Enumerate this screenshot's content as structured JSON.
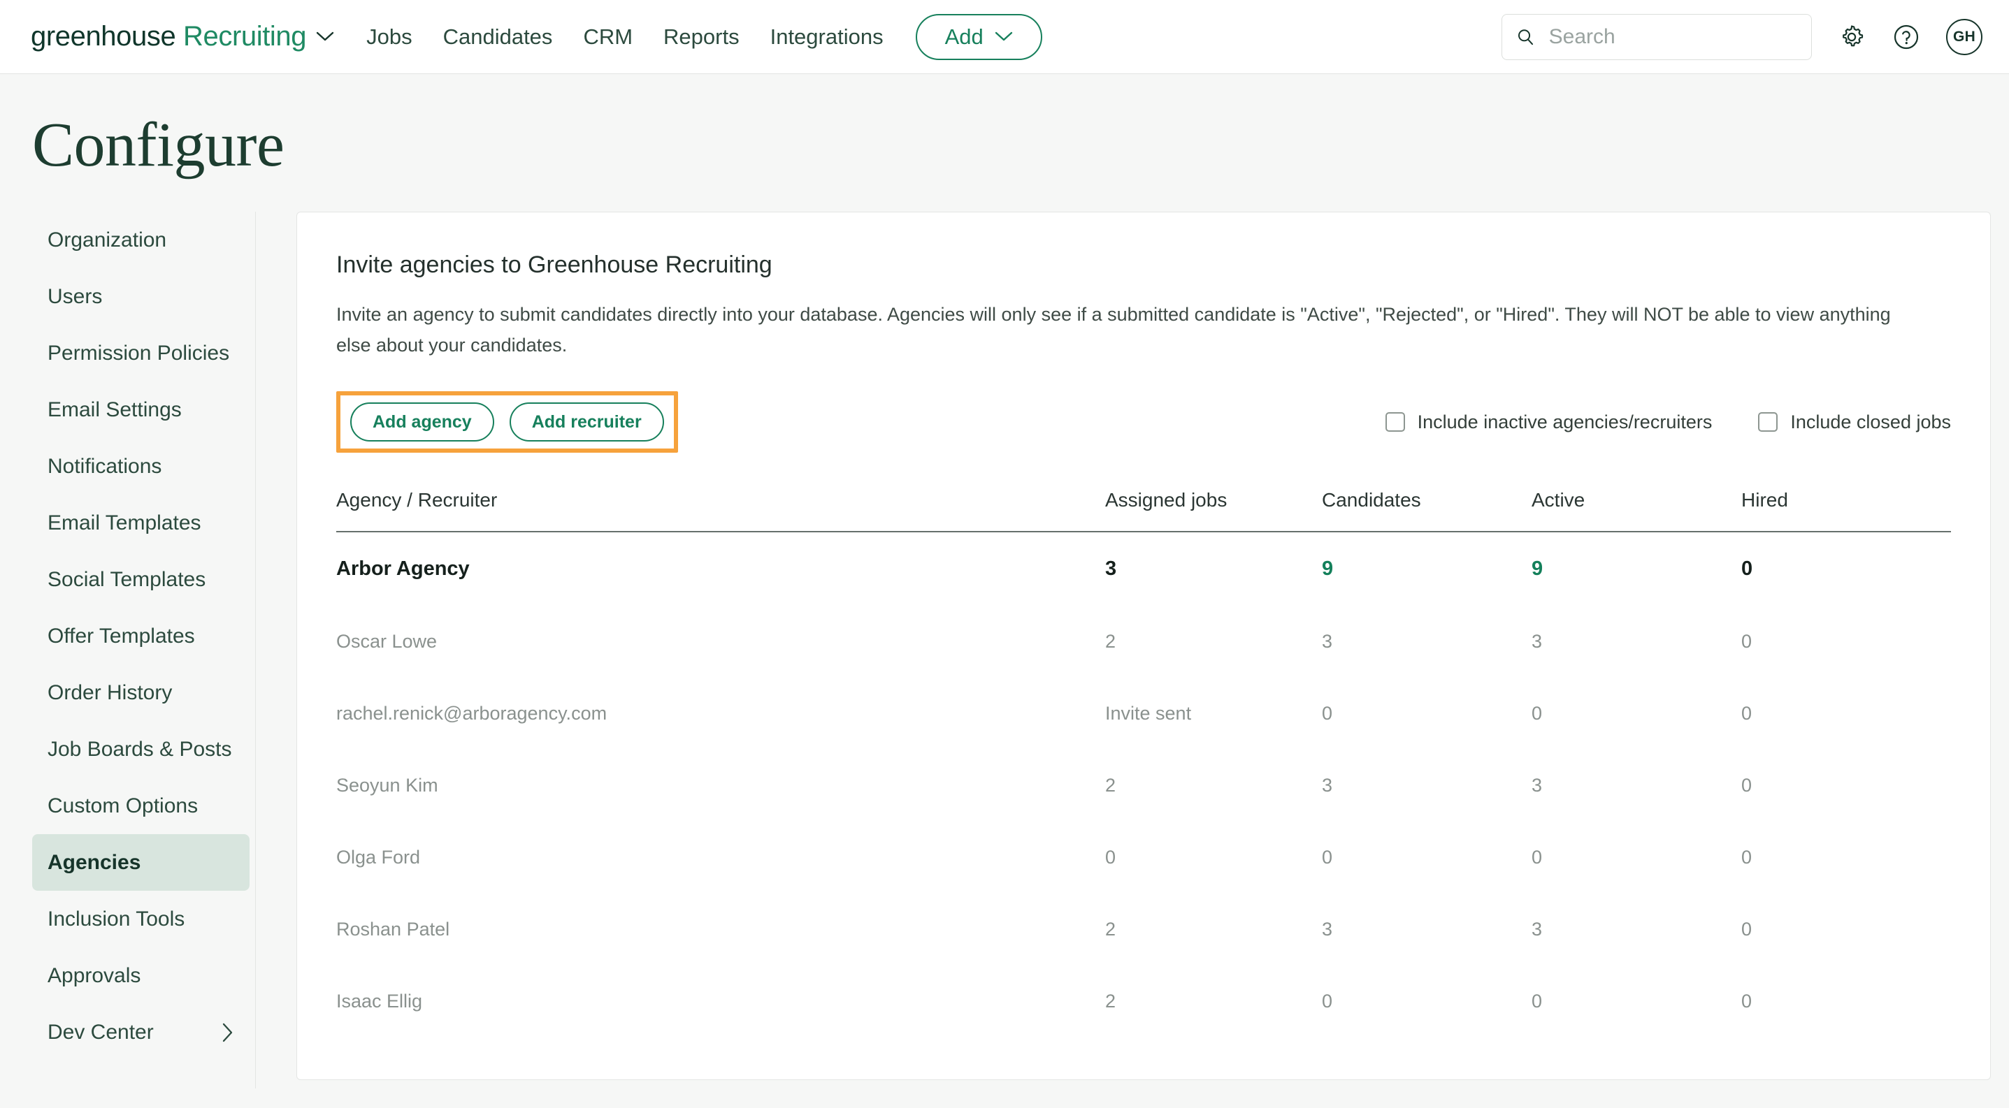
{
  "topnav": {
    "brand_primary": "greenhouse",
    "brand_secondary": "Recruiting",
    "links": [
      "Jobs",
      "Candidates",
      "CRM",
      "Reports",
      "Integrations"
    ],
    "add_label": "Add",
    "search_placeholder": "Search",
    "search_value": "",
    "avatar_initials": "GH",
    "icons": [
      "search-icon",
      "gear-icon",
      "help-icon",
      "avatar"
    ]
  },
  "page": {
    "title": "Configure"
  },
  "sidebar": {
    "items": [
      {
        "label": "Organization",
        "active": false,
        "chevron": false
      },
      {
        "label": "Users",
        "active": false,
        "chevron": false
      },
      {
        "label": "Permission Policies",
        "active": false,
        "chevron": false
      },
      {
        "label": "Email Settings",
        "active": false,
        "chevron": false
      },
      {
        "label": "Notifications",
        "active": false,
        "chevron": false
      },
      {
        "label": "Email Templates",
        "active": false,
        "chevron": false
      },
      {
        "label": "Social Templates",
        "active": false,
        "chevron": false
      },
      {
        "label": "Offer Templates",
        "active": false,
        "chevron": false
      },
      {
        "label": "Order History",
        "active": false,
        "chevron": false
      },
      {
        "label": "Job Boards & Posts",
        "active": false,
        "chevron": false
      },
      {
        "label": "Custom Options",
        "active": false,
        "chevron": false
      },
      {
        "label": "Agencies",
        "active": true,
        "chevron": false
      },
      {
        "label": "Inclusion Tools",
        "active": false,
        "chevron": false
      },
      {
        "label": "Approvals",
        "active": false,
        "chevron": false
      },
      {
        "label": "Dev Center",
        "active": false,
        "chevron": true
      }
    ]
  },
  "card": {
    "title": "Invite agencies to Greenhouse Recruiting",
    "description": "Invite an agency to submit candidates directly into your database. Agencies will only see if a submitted candidate is \"Active\", \"Rejected\", or \"Hired\". They will NOT be able to view anything else about your candidates.",
    "add_agency_label": "Add agency",
    "add_recruiter_label": "Add recruiter",
    "highlight_color": "#f6a23c",
    "checkboxes": [
      {
        "label": "Include inactive agencies/recruiters",
        "checked": false
      },
      {
        "label": "Include closed jobs",
        "checked": false
      }
    ],
    "table": {
      "columns": [
        "Agency / Recruiter",
        "Assigned jobs",
        "Candidates",
        "Active",
        "Hired"
      ],
      "rows": [
        {
          "name": "Arbor Agency",
          "assigned_jobs": "3",
          "candidates": "9",
          "active": "9",
          "hired": "0",
          "type": "agency",
          "candidates_link": true,
          "active_link": true
        },
        {
          "name": "Oscar Lowe",
          "assigned_jobs": "2",
          "candidates": "3",
          "active": "3",
          "hired": "0",
          "type": "recruiter",
          "candidates_link": true,
          "active_link": true
        },
        {
          "name": "rachel.renick@arboragency.com",
          "assigned_jobs": "Invite sent",
          "candidates": "0",
          "active": "0",
          "hired": "0",
          "type": "recruiter",
          "candidates_link": false,
          "active_link": false
        },
        {
          "name": "Seoyun Kim",
          "assigned_jobs": "2",
          "candidates": "3",
          "active": "3",
          "hired": "0",
          "type": "recruiter",
          "candidates_link": true,
          "active_link": true
        },
        {
          "name": "Olga Ford",
          "assigned_jobs": "0",
          "candidates": "0",
          "active": "0",
          "hired": "0",
          "type": "recruiter",
          "candidates_link": false,
          "active_link": false
        },
        {
          "name": "Roshan Patel",
          "assigned_jobs": "2",
          "candidates": "3",
          "active": "3",
          "hired": "0",
          "type": "recruiter",
          "candidates_link": true,
          "active_link": true
        },
        {
          "name": "Isaac Ellig",
          "assigned_jobs": "2",
          "candidates": "0",
          "active": "0",
          "hired": "0",
          "type": "recruiter",
          "candidates_link": false,
          "active_link": false
        }
      ]
    }
  },
  "colors": {
    "brand_green": "#1f8a63",
    "dark_green": "#16342a",
    "link_green": "#14805b",
    "highlight_orange": "#f6a23c",
    "page_bg": "#f6f7f6"
  }
}
